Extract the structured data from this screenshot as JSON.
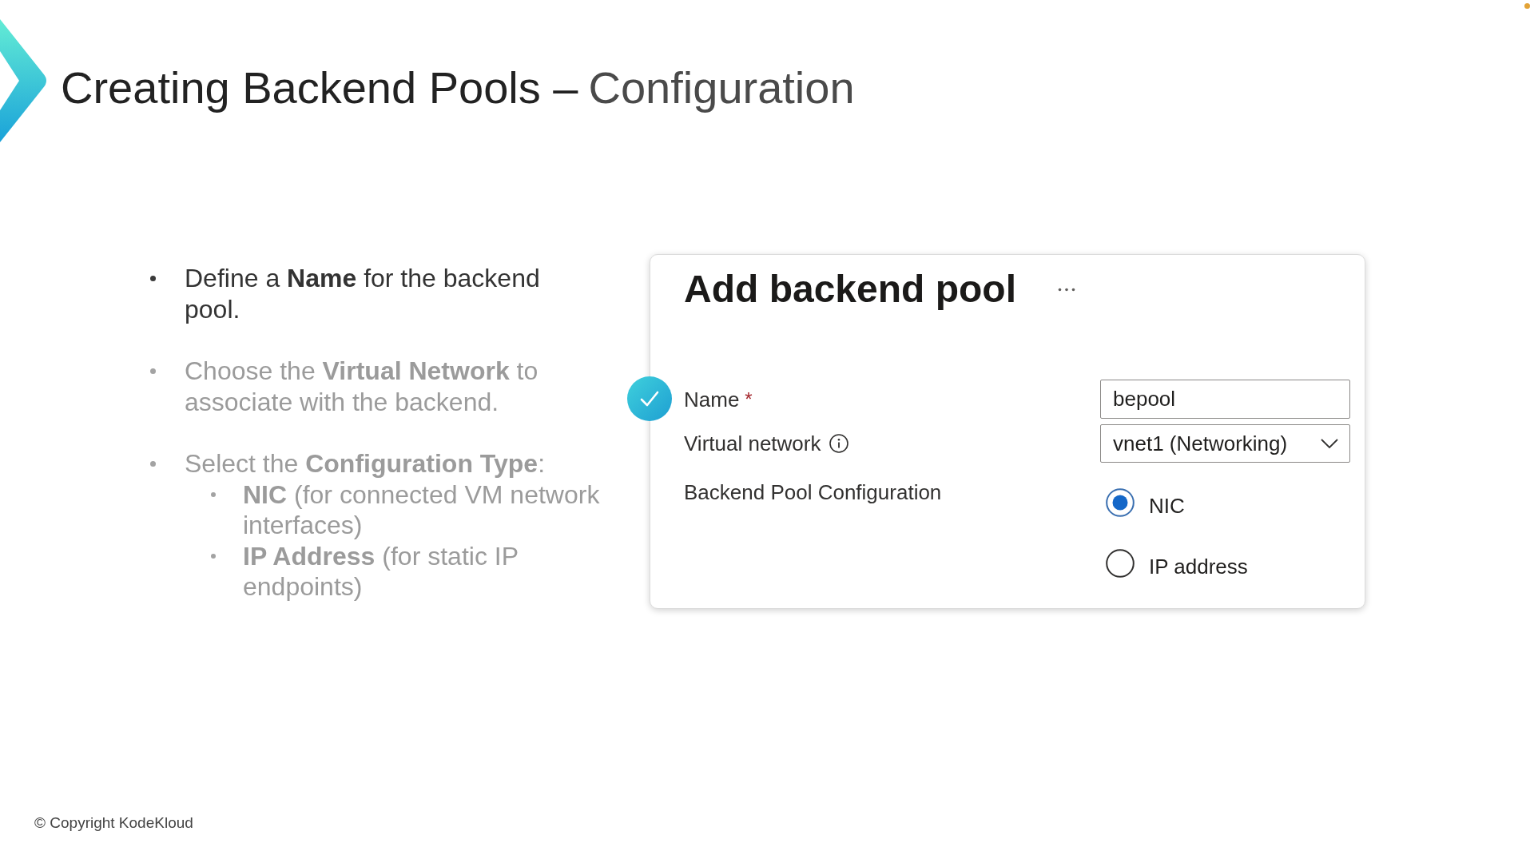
{
  "slide": {
    "title": "Creating Backend Pools –",
    "title_accent": "Configuration"
  },
  "bullets": [
    {
      "text": "Define a **Name** for the backend pool.",
      "dimmed": false
    },
    {
      "text": "Choose the **Virtual Network** to associate with the backend.",
      "dimmed": true
    },
    {
      "text": "Select the **Configuration Type**:",
      "dimmed": true,
      "children": [
        {
          "text": "**NIC** (for connected VM network interfaces)",
          "dimmed": true
        },
        {
          "text": "**IP Address** (for static IP endpoints)",
          "dimmed": true
        }
      ]
    }
  ],
  "panel": {
    "title": "Add backend pool",
    "fields": [
      {
        "kind": "text",
        "label": "Name",
        "required_mark": "*",
        "value": "bepool",
        "marked": true
      },
      {
        "kind": "select",
        "label": "Virtual network",
        "info": true,
        "value": "vnet1 (Networking)",
        "marked": false
      },
      {
        "kind": "radio",
        "label": "Backend Pool Configuration",
        "marked": false,
        "options": [
          {
            "label": "NIC",
            "selected": true
          },
          {
            "label": "IP address",
            "selected": false
          }
        ]
      }
    ]
  },
  "footer": {
    "copyright": "© Copyright KodeKloud"
  }
}
